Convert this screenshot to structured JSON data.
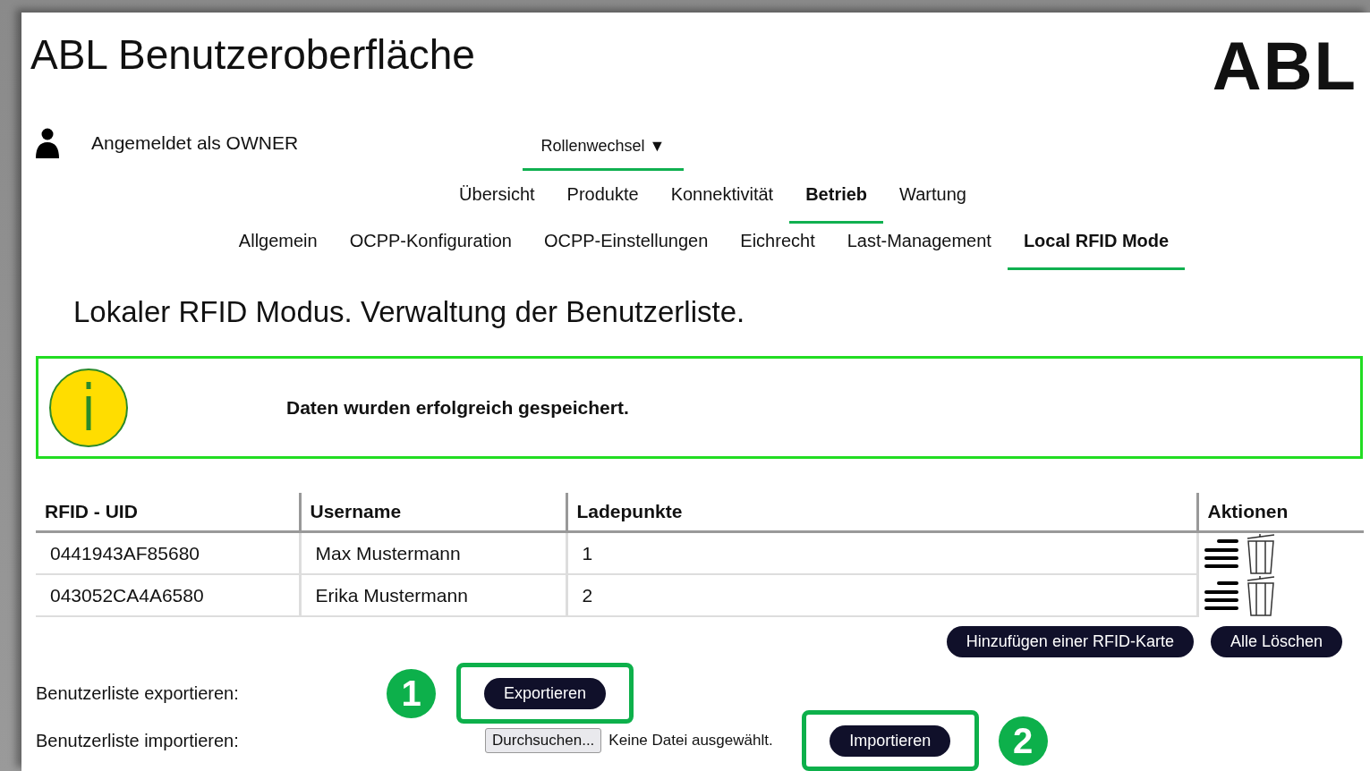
{
  "header": {
    "title": "ABL Benutzeroberfläche",
    "logo": "ABL"
  },
  "user": {
    "label": "Angemeldet als OWNER",
    "role_switch": "Rollenwechsel ▼"
  },
  "main_nav": [
    {
      "label": "Übersicht",
      "selected": false
    },
    {
      "label": "Produkte",
      "selected": false
    },
    {
      "label": "Konnektivität",
      "selected": false
    },
    {
      "label": "Betrieb",
      "selected": true
    },
    {
      "label": "Wartung",
      "selected": false
    }
  ],
  "sub_nav": [
    {
      "label": "Allgemein",
      "selected": false
    },
    {
      "label": "OCPP-Konfiguration",
      "selected": false
    },
    {
      "label": "OCPP-Einstellungen",
      "selected": false
    },
    {
      "label": "Eichrecht",
      "selected": false
    },
    {
      "label": "Last-Management",
      "selected": false
    },
    {
      "label": "Local RFID Mode",
      "selected": true
    }
  ],
  "heading": "Lokaler RFID Modus. Verwaltung der Benutzerliste.",
  "alert": {
    "message": "Daten wurden erfolgreich gespeichert."
  },
  "table": {
    "columns": [
      "RFID - UID",
      "Username",
      "Ladepunkte",
      "Aktionen"
    ],
    "rows": [
      [
        "0441943AF85680",
        "Max Mustermann",
        "1"
      ],
      [
        "043052CA4A6580",
        "Erika Mustermann",
        "2"
      ]
    ]
  },
  "table_buttons": [
    "Hinzufügen einer RFID-Karte",
    "Alle Löschen"
  ],
  "export": {
    "label": "Benutzerliste exportieren:",
    "button": "Exportieren",
    "marker": "1"
  },
  "import": {
    "label": "Benutzerliste importieren:",
    "browse": "Durchsuchen...",
    "file_status": "Keine Datei ausgewählt.",
    "button": "Importieren",
    "marker": "2"
  }
}
